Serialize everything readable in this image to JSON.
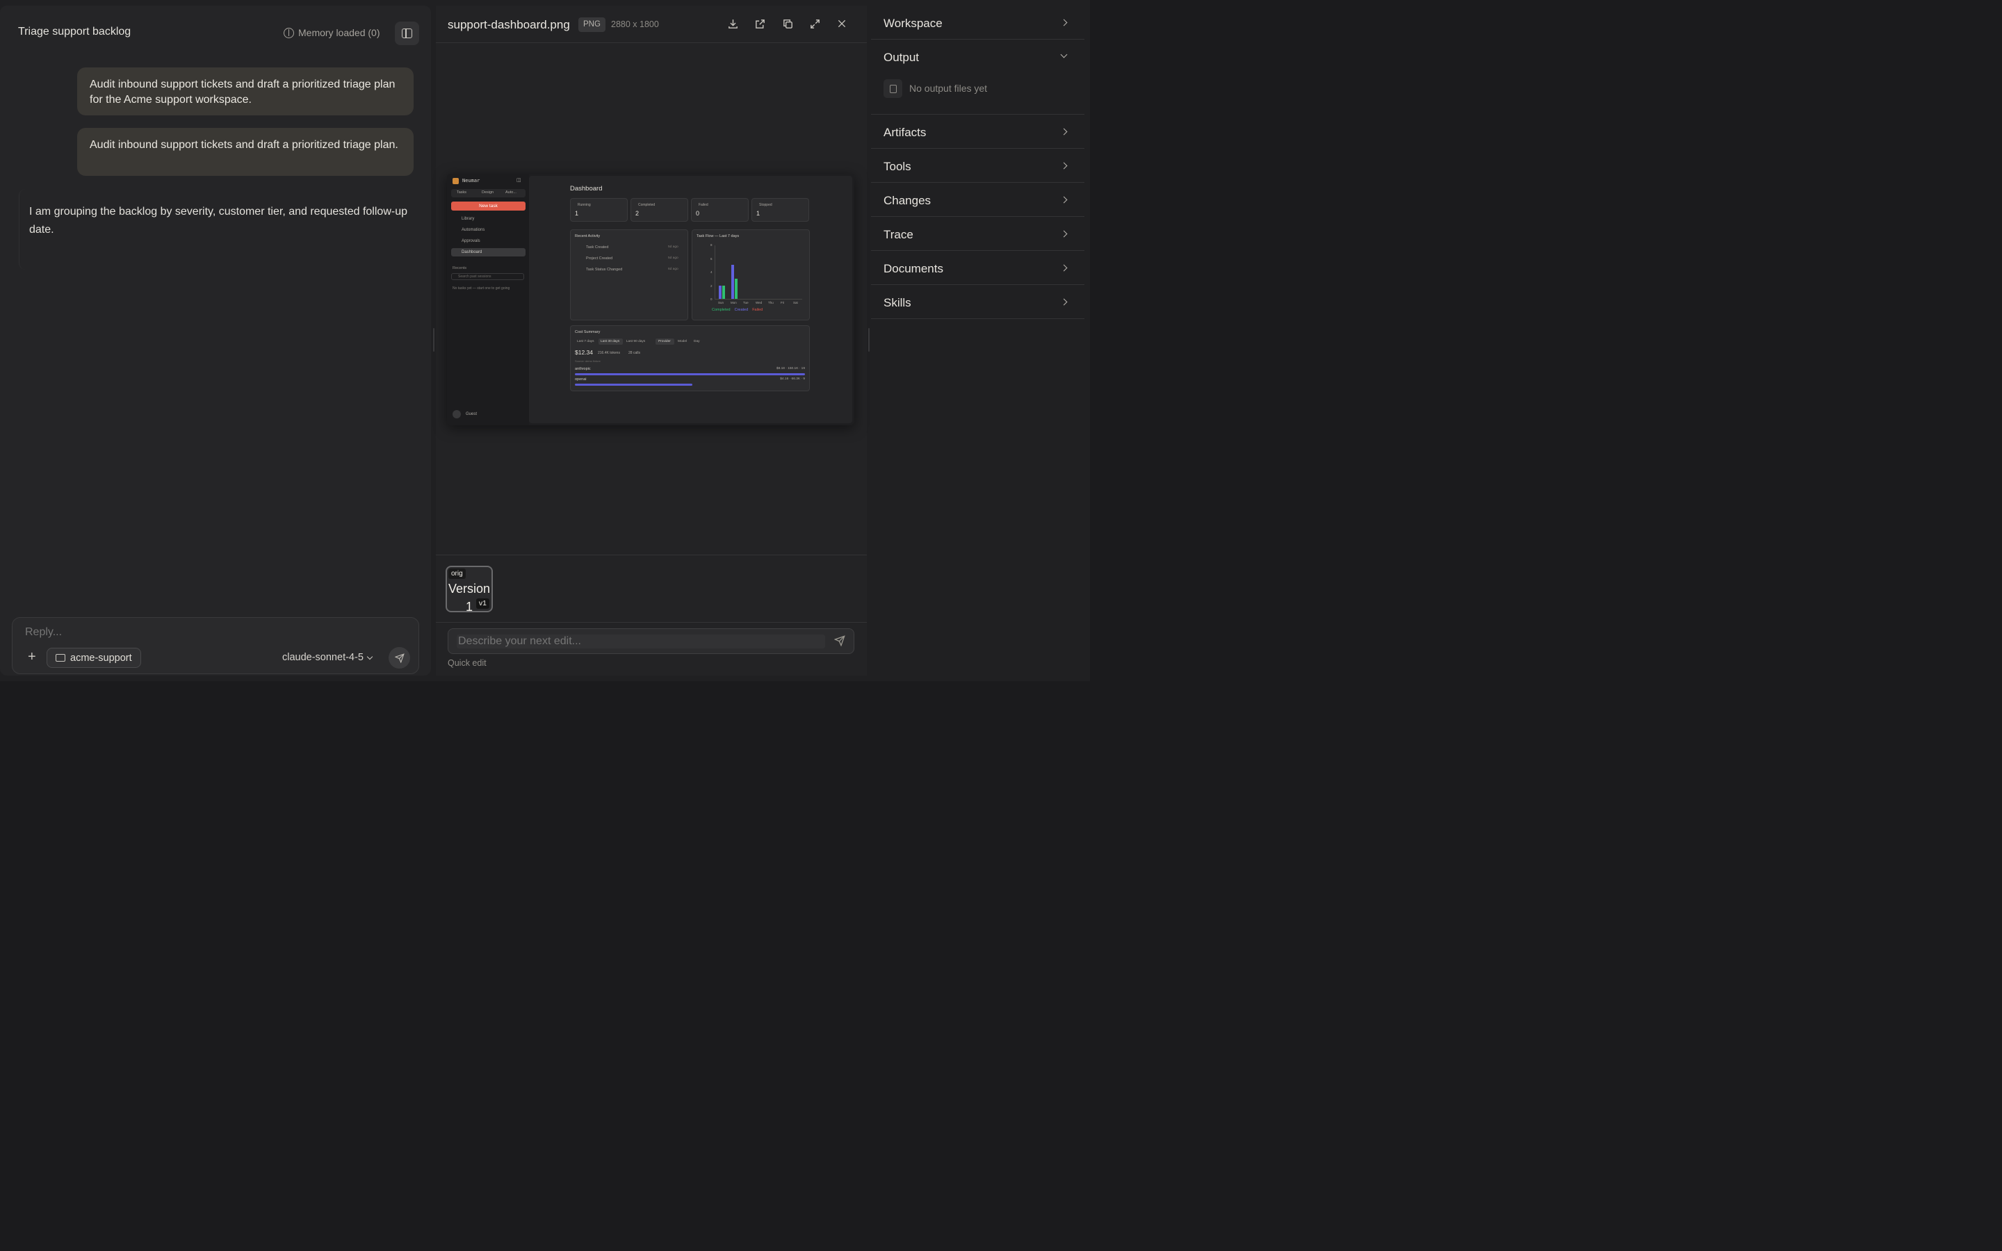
{
  "chat": {
    "title": "Triage support backlog",
    "memory_label": "Memory loaded (0)",
    "messages": [
      {
        "role": "user",
        "text": "Audit inbound support tickets and draft a prioritized triage plan for the Acme support workspace."
      },
      {
        "role": "user",
        "text": "Audit inbound support tickets and draft a prioritized triage plan."
      },
      {
        "role": "assistant",
        "text": "I am grouping the backlog by severity, customer tier, and requested follow-up date."
      }
    ],
    "composer": {
      "placeholder": "Reply...",
      "workspace_chip": "acme-support",
      "model": "claude-sonnet-4-5"
    }
  },
  "preview": {
    "file_name": "support-dashboard.png",
    "format": "PNG",
    "dimensions": "2880 x 1800",
    "toolbar_icons": [
      "download-icon",
      "open-external-icon",
      "copy-icon",
      "expand-icon",
      "close-icon"
    ],
    "screenshot": {
      "brand": "Neumar",
      "tabs": [
        "Tasks",
        "Design",
        "Auto..."
      ],
      "new_task": "New task",
      "nav": [
        "Library",
        "Automations",
        "Approvals",
        "Dashboard"
      ],
      "recents_label": "Recents",
      "search_placeholder": "Search past sessions",
      "empty_recents": "No tasks yet — start one to get going",
      "user": "Guest",
      "dashboard_title": "Dashboard",
      "stats": [
        {
          "label": "Running",
          "value": "1"
        },
        {
          "label": "Completed",
          "value": "2"
        },
        {
          "label": "Failed",
          "value": "0"
        },
        {
          "label": "Stopped",
          "value": "1"
        }
      ],
      "recent_activity": {
        "title": "Recent Activity",
        "items": [
          {
            "label": "Task Created",
            "time": "5d ago"
          },
          {
            "label": "Project Created",
            "time": "5d ago"
          },
          {
            "label": "Task Status Changed",
            "time": "6d ago"
          }
        ]
      },
      "task_flow": {
        "title": "Task Flow — Last 7 days",
        "days": [
          "Sun",
          "Mon",
          "Tue",
          "Wed",
          "Thu",
          "Fri",
          "Sat"
        ],
        "legend": [
          "Completed",
          "Created",
          "Failed"
        ],
        "y_ticks": [
          "0",
          "2",
          "4",
          "6",
          "8"
        ],
        "series": {
          "Created": [
            2,
            5,
            0,
            0,
            0,
            0,
            0
          ],
          "Completed": [
            2,
            3,
            0,
            0,
            0,
            0,
            0
          ],
          "Failed": [
            0,
            0,
            0,
            0,
            0,
            0,
            0
          ]
        },
        "colors": {
          "Completed": "#2fbf71",
          "Created": "#6060e0",
          "Failed": "#e0554a"
        }
      },
      "cost_summary": {
        "title": "Cost Summary",
        "ranges": [
          "Last 7 days",
          "Last 30 days",
          "Last 90 days"
        ],
        "groupings": [
          "Provider",
          "Model",
          "Day"
        ],
        "total": "$12.34",
        "tokens": "216.4K tokens",
        "calls": "28 calls",
        "note": "Source: demo fixture",
        "providers": [
          {
            "name": "anthropic",
            "stats": "$8.18 · 150.1K · 19",
            "share": 1.0
          },
          {
            "name": "openai",
            "stats": "$4.16 · 66.3K · 9",
            "share": 0.51
          }
        ]
      }
    },
    "versions": [
      {
        "label": "Version 1",
        "tag": "orig",
        "badge": "v1"
      }
    ],
    "edit_placeholder": "Describe your next edit...",
    "quick_edit": "Quick edit"
  },
  "sidebar": {
    "sections": [
      {
        "label": "Workspace",
        "expanded": false
      },
      {
        "label": "Output",
        "expanded": true,
        "empty_text": "No output files yet"
      },
      {
        "label": "Artifacts",
        "expanded": false
      },
      {
        "label": "Tools",
        "expanded": false
      },
      {
        "label": "Changes",
        "expanded": false
      },
      {
        "label": "Trace",
        "expanded": false
      },
      {
        "label": "Documents",
        "expanded": false
      },
      {
        "label": "Skills",
        "expanded": false
      }
    ]
  }
}
